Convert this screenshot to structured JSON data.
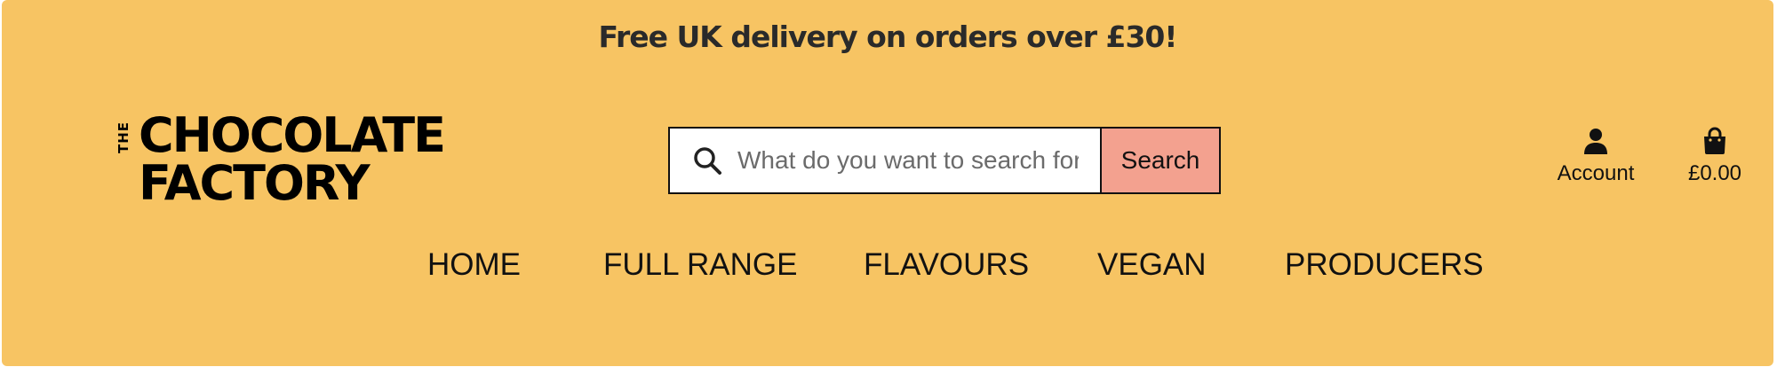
{
  "promo": {
    "text": "Free UK delivery on orders over £30!"
  },
  "logo": {
    "the": "THE",
    "line1": "CHOCOLATE",
    "line2": "FACTORY"
  },
  "search": {
    "placeholder": "What do you want to search for?",
    "value": "",
    "button_label": "Search",
    "icon": "search-icon"
  },
  "account": {
    "label": "Account",
    "icon": "user-icon"
  },
  "cart": {
    "label": "£0.00",
    "icon": "shopping-bag-icon"
  },
  "nav": {
    "items": [
      {
        "label": "HOME"
      },
      {
        "label": "FULL RANGE"
      },
      {
        "label": "FLAVOURS"
      },
      {
        "label": "VEGAN"
      },
      {
        "label": "PRODUCERS"
      }
    ]
  },
  "colors": {
    "background": "#f7c463",
    "search_button": "#f3a18f",
    "text": "#111111"
  }
}
